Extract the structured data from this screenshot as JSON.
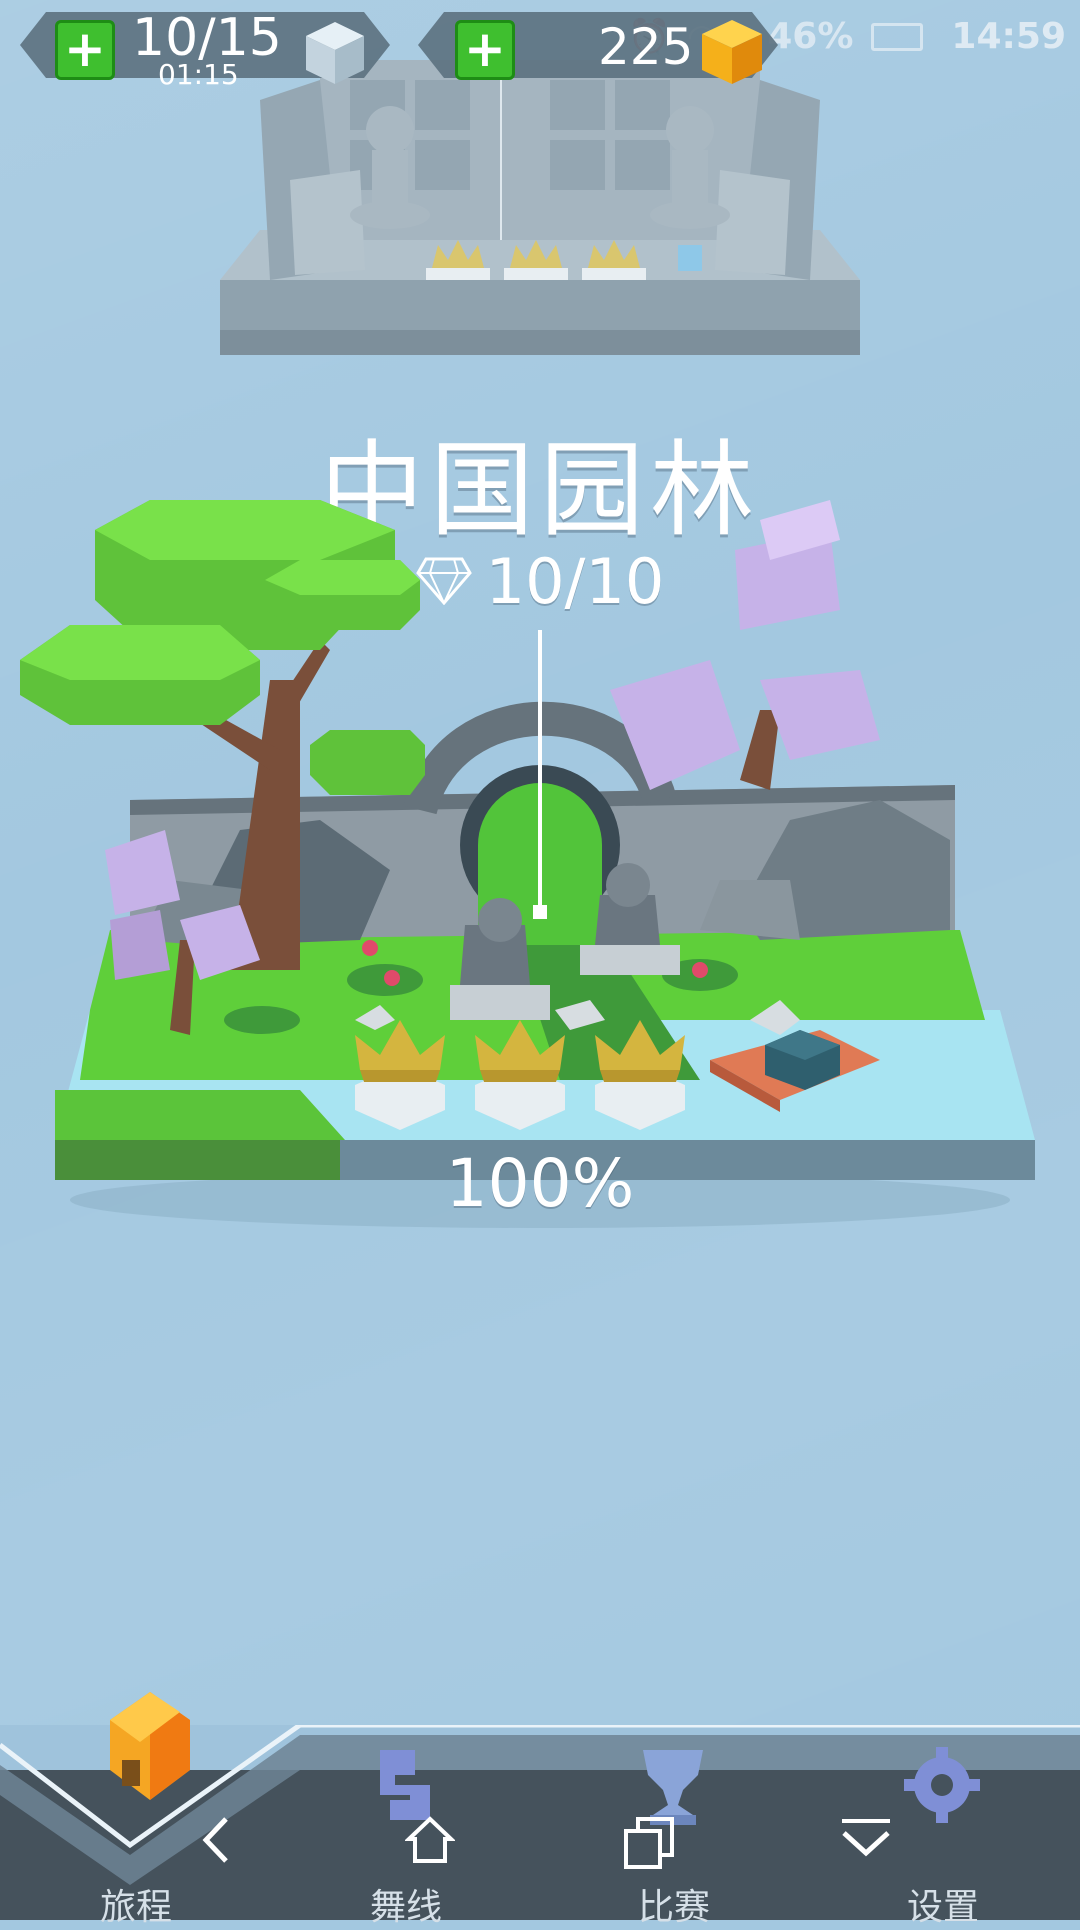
{
  "status_bar": {
    "battery_percent": "46%",
    "time": "14:59"
  },
  "hud": {
    "lives": "10/15",
    "lives_timer": "01:15",
    "gems": "225"
  },
  "world": {
    "title": "中国园林",
    "diamonds": "10/10",
    "completion": "100%",
    "crowns_earned": 3
  },
  "nav": {
    "tabs": [
      {
        "label": "旅程",
        "icon": "house-icon",
        "active": true
      },
      {
        "label": "舞线",
        "icon": "dance-line-icon",
        "active": false
      },
      {
        "label": "比赛",
        "icon": "trophy-icon",
        "active": false
      },
      {
        "label": "设置",
        "icon": "gear-icon",
        "active": false
      }
    ]
  },
  "colors": {
    "sky": "#a3c8e0",
    "grass": "#5fcf3a",
    "blossom": "#c6b2e8",
    "bottom_bar": "#45525c",
    "gem_gold": "#f5b01a"
  }
}
